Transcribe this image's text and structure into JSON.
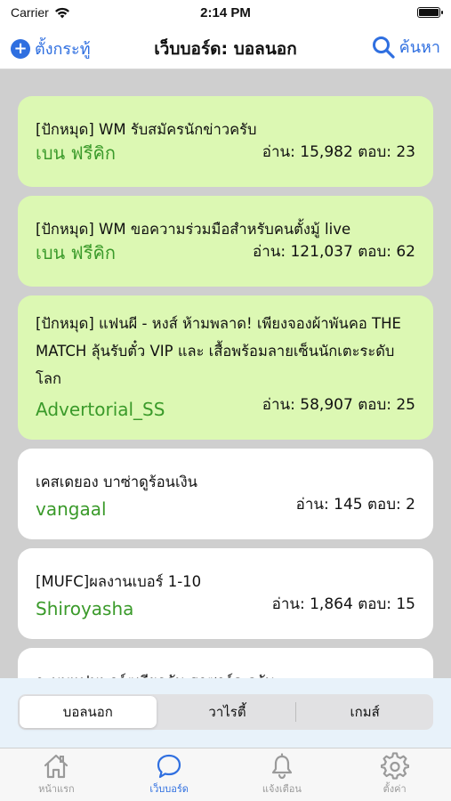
{
  "status_bar": {
    "carrier": "Carrier",
    "time": "2:14 PM"
  },
  "nav": {
    "left_label": "ตั้งกระทู้",
    "title": "เว็บบอร์ด: บอลนอก",
    "right_label": "ค้นหา",
    "accent_color": "#2f6fe0"
  },
  "posts": [
    {
      "title": "[ปักหมุด] WM รับสมัครนักข่าวครับ",
      "author": "เบน ฟรีคิก",
      "stats": "อ่าน: 15,982 ตอบ: 23",
      "pinned": true
    },
    {
      "title": "[ปักหมุด] WM ขอความร่วมมือสำหรับคนตั้งมู้ live",
      "author": "เบน ฟรีคิก",
      "stats": "อ่าน: 121,037 ตอบ: 62",
      "pinned": true
    },
    {
      "title": "[ปักหมุด] แฟนผี - หงส์ ห้ามพลาด! เพียงจองผ้าพันคอ THE MATCH ลุ้นรับตั๋ว VIP และ เสื้อพร้อมลายเซ็นนักเตะระดับโลก",
      "author": "Advertorial_SS",
      "stats": "อ่าน: 58,907 ตอบ: 25",
      "pinned": true
    },
    {
      "title": "เคสเดยอง บาซ่าดูร้อนเงิน",
      "author": "vangaal",
      "stats": "อ่าน: 145 ตอบ: 2",
      "pinned": false
    },
    {
      "title": "[MUFC]ผลงานเบอร์ 1-10",
      "author": "Shiroyasha",
      "stats": "อ่าน: 1,864 ตอบ: 15",
      "pinned": false
    },
    {
      "title": "ระบบแฟนพอร์ตเรียกกัน ฮาซาร์ด ครับ",
      "author": "",
      "stats": "",
      "pinned": false
    }
  ],
  "segments": {
    "items": [
      "บอลนอก",
      "วาไรตี้",
      "เกมส์"
    ],
    "selected": "บอลนอก"
  },
  "tabbar": {
    "items": [
      {
        "label": "หน้าแรก",
        "icon": "home-icon"
      },
      {
        "label": "เว็บบอร์ด",
        "icon": "chat-bubble-icon"
      },
      {
        "label": "แจ้งเตือน",
        "icon": "bell-icon"
      },
      {
        "label": "ตั้งค่า",
        "icon": "gear-icon"
      }
    ],
    "selected": "เว็บบอร์ด"
  },
  "colors": {
    "pinned_card": "#dcf8b3",
    "author_green": "#3a9a2a",
    "background": "#cfcfcf"
  }
}
